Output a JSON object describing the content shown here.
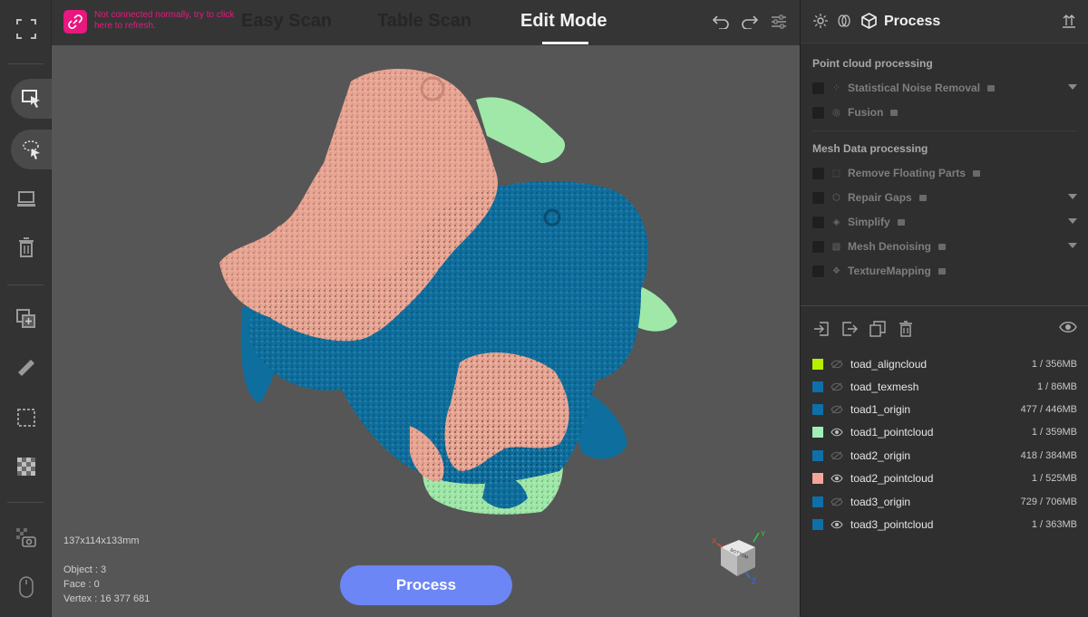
{
  "connection": {
    "text": "Not connected normally, try to click here to refresh."
  },
  "mode_tabs": [
    {
      "label": "Easy Scan"
    },
    {
      "label": "Table Scan"
    },
    {
      "label": "Edit Mode"
    }
  ],
  "active_mode": "Edit Mode",
  "viewport": {
    "dimensions": "137x114x133mm",
    "object_count": "Object : 3",
    "face_count": "Face : 0",
    "vertex_count": "Vertex : 16 377 681",
    "process_label": "Process",
    "navcube_label": "BOTTOM",
    "axes": {
      "x": "X",
      "y": "Y",
      "z": "Z"
    }
  },
  "panel": {
    "title": "Process",
    "point_cloud_section": "Point cloud processing",
    "point_cloud_items": [
      {
        "label": "Statistical Noise Removal",
        "icon": "noise-icon",
        "has_dropdown": true
      },
      {
        "label": "Fusion",
        "icon": "fusion-icon",
        "has_dropdown": false
      }
    ],
    "mesh_section": "Mesh Data processing",
    "mesh_items": [
      {
        "label": "Remove Floating Parts",
        "icon": "floating-icon",
        "has_dropdown": false
      },
      {
        "label": "Repair Gaps",
        "icon": "repair-icon",
        "has_dropdown": true
      },
      {
        "label": "Simplify",
        "icon": "simplify-icon",
        "has_dropdown": true
      },
      {
        "label": "Mesh Denoising",
        "icon": "denoise-icon",
        "has_dropdown": true
      },
      {
        "label": "TextureMapping",
        "icon": "texture-icon",
        "has_dropdown": false
      }
    ]
  },
  "objects": [
    {
      "name": "toad_aligncloud",
      "size": "1 / 356MB",
      "color": "#b6f000",
      "visible": false
    },
    {
      "name": "toad_texmesh",
      "size": "1 / 86MB",
      "color": "#0f6fa8",
      "visible": false
    },
    {
      "name": "toad1_origin",
      "size": "477 / 446MB",
      "color": "#0f6fa8",
      "visible": false
    },
    {
      "name": "toad1_pointcloud",
      "size": "1 / 359MB",
      "color": "#9ff0b4",
      "visible": true
    },
    {
      "name": "toad2_origin",
      "size": "418 / 384MB",
      "color": "#0f6fa8",
      "visible": false
    },
    {
      "name": "toad2_pointcloud",
      "size": "1 / 525MB",
      "color": "#f3a69a",
      "visible": true
    },
    {
      "name": "toad3_origin",
      "size": "729 / 706MB",
      "color": "#0f6fa8",
      "visible": false
    },
    {
      "name": "toad3_pointcloud",
      "size": "1 / 363MB",
      "color": "#0f6fa8",
      "visible": true
    }
  ],
  "colors": {
    "accent": "#6c86f5",
    "warning": "#e8187e",
    "blue_toad": "#0e6f9e",
    "pink_toad": "#e9a593",
    "green_toad": "#9fe8a8"
  }
}
